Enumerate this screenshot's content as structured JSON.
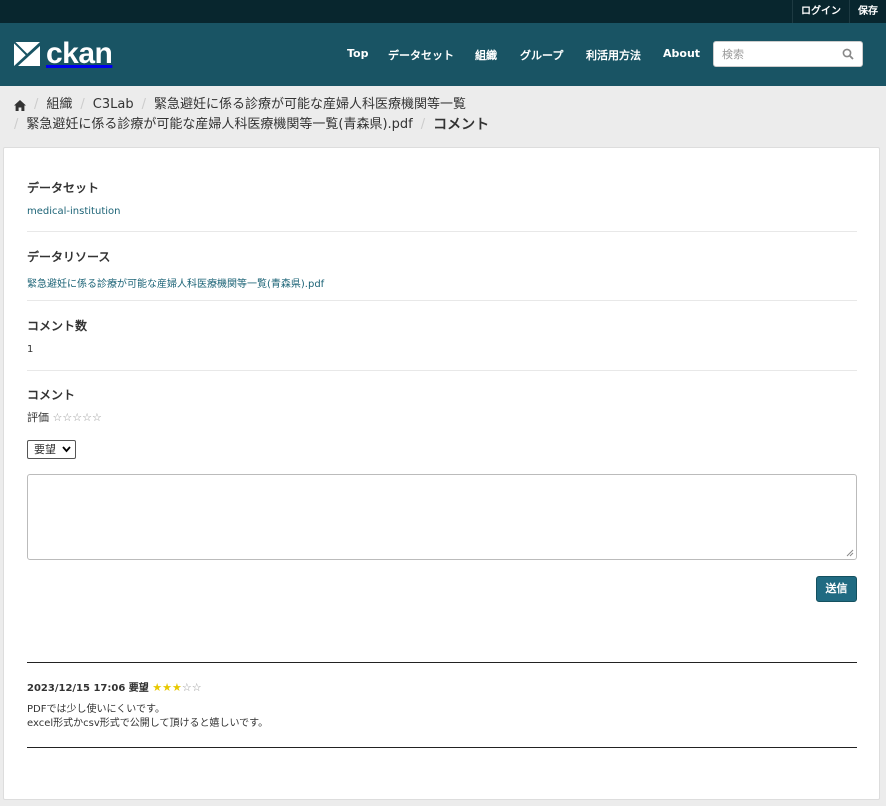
{
  "account": {
    "login": "ログイン",
    "save": "保存"
  },
  "brand": {
    "name": "ckan"
  },
  "nav": [
    "Top",
    "データセット",
    "組織",
    "グループ",
    "利活用方法",
    "About"
  ],
  "search": {
    "placeholder": "検索"
  },
  "breadcrumb": {
    "items": [
      "組織",
      "C3Lab",
      "緊急避妊に係る診療が可能な産婦人科医療機関等一覧",
      "緊急避妊に係る診療が可能な産婦人科医療機関等一覧(青森県).pdf"
    ],
    "active": "コメント"
  },
  "fields": {
    "dataset": {
      "label": "データセット",
      "value": "medical-institution"
    },
    "resource": {
      "label": "データリソース",
      "value": "緊急避妊に係る診療が可能な産婦人科医療機関等一覧(青森県).pdf"
    },
    "count": {
      "label": "コメント数",
      "value": "1"
    },
    "comment": {
      "label": "コメント"
    }
  },
  "form": {
    "rating_label": "評価",
    "rating_value": 0,
    "category_selected": "要望",
    "textarea_value": "",
    "submit_label": "送信"
  },
  "comments": [
    {
      "header": "2023/12/15 17:06 要望",
      "rating": 3,
      "max_rating": 5,
      "lines": [
        "PDFでは少し使いにくいです。",
        "excel形式かcsv形式で公開して頂けると嬉しいです。"
      ]
    }
  ]
}
